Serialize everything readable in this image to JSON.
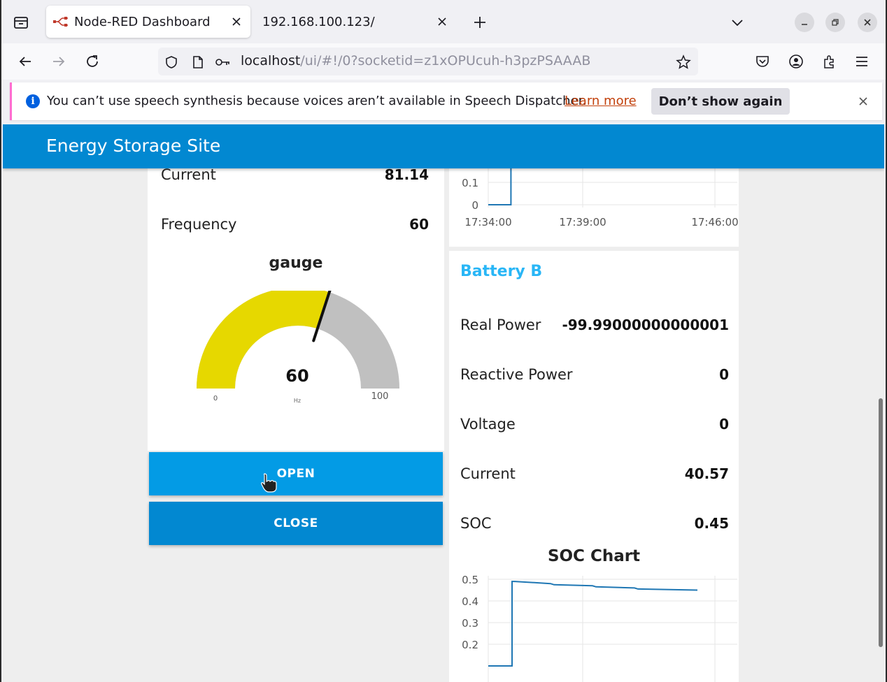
{
  "browser": {
    "tabs": [
      {
        "title": "Node-RED Dashboard",
        "active": true
      },
      {
        "title": "192.168.100.123/",
        "active": false
      }
    ],
    "url_host": "localhost",
    "url_path": "/ui/#!/0?socketid=z1xOPUcuh-h3pzPSAAAB"
  },
  "notification": {
    "message": "You can’t use speech synthesis because voices aren’t available in Speech Dispatcher.",
    "link": "Learn more",
    "button": "Don’t show again"
  },
  "dashboard": {
    "title": "Energy Storage Site",
    "accent": "#0288d1",
    "left_group": {
      "rows": [
        {
          "label": "Current",
          "value": "81.14"
        },
        {
          "label": "Frequency",
          "value": "60"
        }
      ],
      "gauge": {
        "title": "gauge",
        "value": 60,
        "value_text": "60",
        "units": "Hz",
        "min_text": "0",
        "max_text": "100",
        "min": 0,
        "max": 100,
        "fill_color": "#e6d800",
        "track_color": "#c0c0c0"
      },
      "buttons": {
        "open": "OPEN",
        "close": "CLOSE"
      }
    },
    "top_chart": {
      "y_ticks": [
        "0.1",
        "0"
      ],
      "x_ticks": [
        "17:34:00",
        "17:39:00",
        "17:46:00"
      ]
    },
    "battery_b": {
      "title": "Battery B",
      "rows": [
        {
          "label": "Real Power",
          "value": "-99.99000000000001"
        },
        {
          "label": "Reactive Power",
          "value": "0"
        },
        {
          "label": "Voltage",
          "value": "0"
        },
        {
          "label": "Current",
          "value": "40.57"
        },
        {
          "label": "SOC",
          "value": "0.45"
        }
      ]
    },
    "soc_chart": {
      "title": "SOC Chart",
      "y_ticks": [
        "0.5",
        "0.4",
        "0.3",
        "0.2"
      ]
    }
  },
  "chart_data": [
    {
      "type": "line",
      "title": "",
      "x": [
        "17:34:00",
        "17:35:30",
        "17:35:30",
        "17:46:00"
      ],
      "values": [
        0,
        0,
        0.2,
        0.2
      ],
      "ylim": [
        0,
        0.2
      ],
      "x_ticks": [
        "17:34:00",
        "17:39:00",
        "17:46:00"
      ],
      "grid": true
    },
    {
      "type": "line",
      "title": "SOC Chart",
      "x_minutes_after_start": [
        0,
        1.5,
        1.5,
        12
      ],
      "series": [
        {
          "values": [
            0.1,
            0.1,
            0.49,
            0.49,
            0.48,
            0.475,
            0.47,
            0.465,
            0.46,
            0.455,
            0.45
          ]
        }
      ],
      "ylim": [
        0.1,
        0.5
      ],
      "grid": true
    }
  ]
}
